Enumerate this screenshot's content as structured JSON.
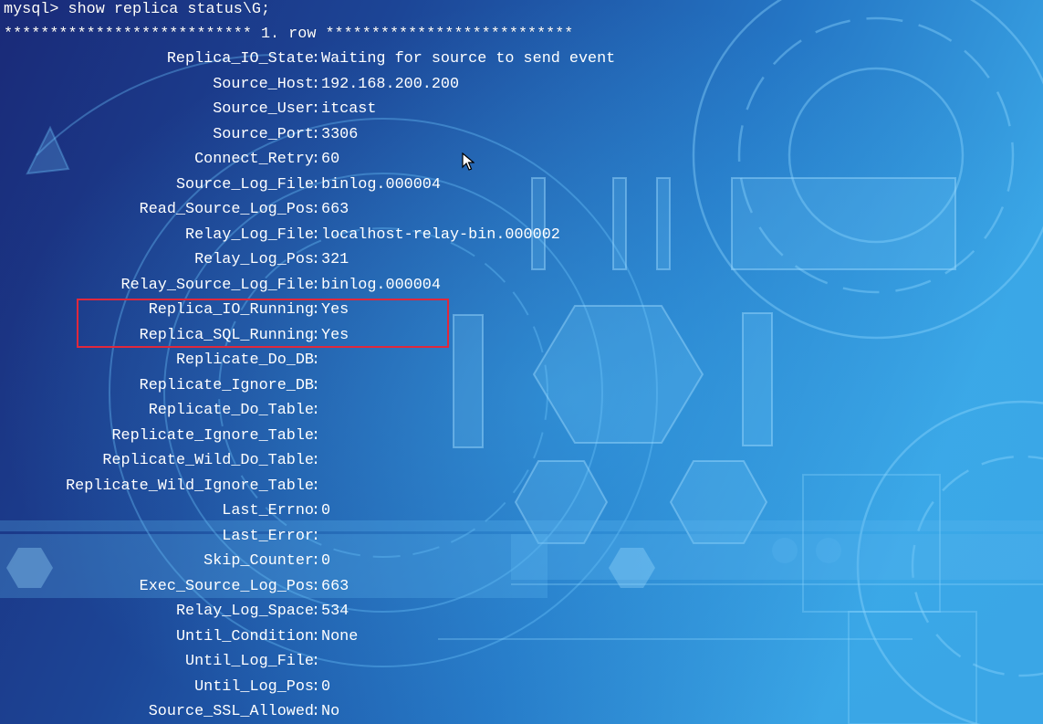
{
  "terminal": {
    "prompt": "mysql> show replica status\\G;",
    "row_header": "*************************** 1. row ***************************",
    "fields": [
      {
        "name": "Replica_IO_State",
        "value": "Waiting for source to send event"
      },
      {
        "name": "Source_Host",
        "value": "192.168.200.200"
      },
      {
        "name": "Source_User",
        "value": "itcast"
      },
      {
        "name": "Source_Port",
        "value": "3306"
      },
      {
        "name": "Connect_Retry",
        "value": "60"
      },
      {
        "name": "Source_Log_File",
        "value": "binlog.000004"
      },
      {
        "name": "Read_Source_Log_Pos",
        "value": "663"
      },
      {
        "name": "Relay_Log_File",
        "value": "localhost-relay-bin.000002"
      },
      {
        "name": "Relay_Log_Pos",
        "value": "321"
      },
      {
        "name": "Relay_Source_Log_File",
        "value": "binlog.000004"
      },
      {
        "name": "Replica_IO_Running",
        "value": "Yes"
      },
      {
        "name": "Replica_SQL_Running",
        "value": "Yes"
      },
      {
        "name": "Replicate_Do_DB",
        "value": ""
      },
      {
        "name": "Replicate_Ignore_DB",
        "value": ""
      },
      {
        "name": "Replicate_Do_Table",
        "value": ""
      },
      {
        "name": "Replicate_Ignore_Table",
        "value": ""
      },
      {
        "name": "Replicate_Wild_Do_Table",
        "value": ""
      },
      {
        "name": "Replicate_Wild_Ignore_Table",
        "value": ""
      },
      {
        "name": "Last_Errno",
        "value": "0"
      },
      {
        "name": "Last_Error",
        "value": ""
      },
      {
        "name": "Skip_Counter",
        "value": "0"
      },
      {
        "name": "Exec_Source_Log_Pos",
        "value": "663"
      },
      {
        "name": "Relay_Log_Space",
        "value": "534"
      },
      {
        "name": "Until_Condition",
        "value": "None"
      },
      {
        "name": "Until_Log_File",
        "value": ""
      },
      {
        "name": "Until_Log_Pos",
        "value": "0"
      },
      {
        "name": "Source_SSL_Allowed",
        "value": "No"
      }
    ]
  },
  "colors": {
    "text": "#ffffff",
    "highlight_border": "#e0283c",
    "background_dark": "#1a2f7a",
    "background_light": "#2a8fd8"
  }
}
